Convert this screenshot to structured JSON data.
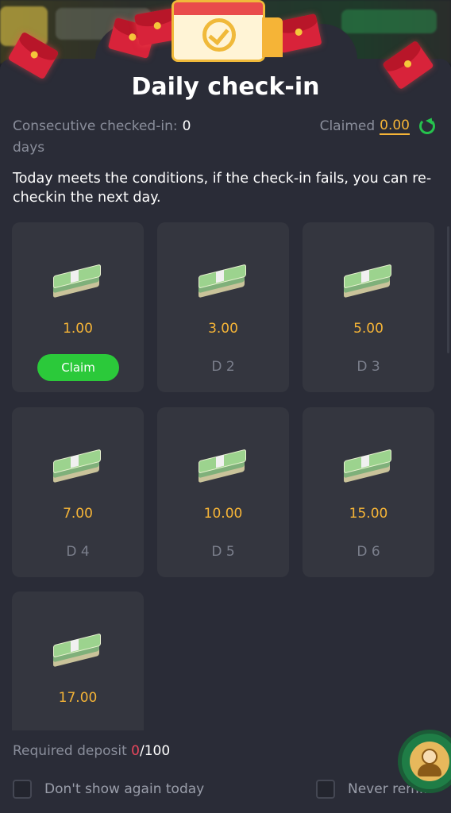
{
  "header": {
    "title": "Daily check-in"
  },
  "status": {
    "consecutive_label": "Consecutive checked-in:",
    "consecutive_value": "0",
    "consecutive_unit": "days",
    "claimed_label": "Claimed",
    "claimed_value": "0.00"
  },
  "note": "Today meets the conditions, if the check-in fails, you can re-checkin the next day.",
  "rewards": [
    {
      "amount": "1.00",
      "day": "",
      "action": "Claim"
    },
    {
      "amount": "3.00",
      "day": "D 2"
    },
    {
      "amount": "5.00",
      "day": "D 3"
    },
    {
      "amount": "7.00",
      "day": "D 4"
    },
    {
      "amount": "10.00",
      "day": "D 5"
    },
    {
      "amount": "15.00",
      "day": "D 6"
    },
    {
      "amount": "17.00",
      "day": ""
    }
  ],
  "deposit": {
    "label": "Required deposit",
    "current": "0",
    "total": "/100"
  },
  "options": {
    "dont_show_today": "Don't show again today",
    "never_remind": "Never rem..."
  },
  "colors": {
    "accent": "#f5b437",
    "claim_button": "#2bc93a",
    "background": "#1e2029",
    "card": "#34363f"
  },
  "icons": [
    "envelope-icon",
    "calendar-check-icon",
    "refresh-icon",
    "cash-stack-icon",
    "customer-support-icon",
    "checkbox-icon"
  ]
}
